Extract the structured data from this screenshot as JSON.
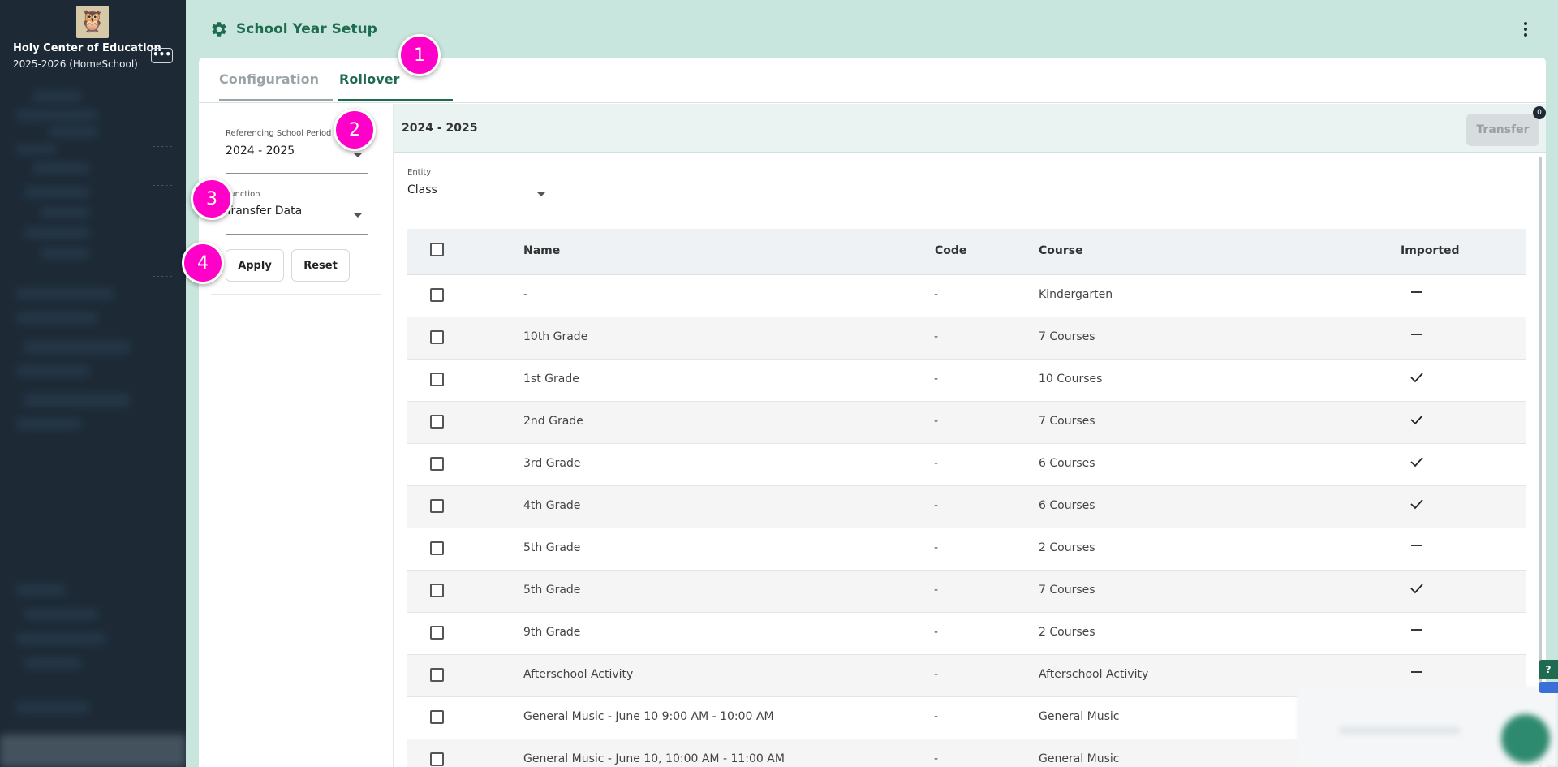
{
  "sidebar": {
    "school_name": "Holy Center of Education",
    "school_year": "2025-2026 (HomeSchool)",
    "more_label": "•••",
    "logo_icon": "owl-logo"
  },
  "header": {
    "title": "School Year Setup",
    "icon": "gear-icon"
  },
  "tabs": [
    {
      "label": "Configuration",
      "active": false
    },
    {
      "label": "Rollover",
      "active": true
    }
  ],
  "filters": {
    "referencing_period_label": "Referencing School Period",
    "referencing_period_value": "2024 - 2025",
    "function_label": "Function",
    "function_value": "Transfer Data",
    "apply_label": "Apply",
    "reset_label": "Reset"
  },
  "content": {
    "period_title": "2024 - 2025",
    "transfer_label": "Transfer",
    "transfer_count": "0",
    "entity_label": "Entity",
    "entity_value": "Class"
  },
  "table": {
    "columns": [
      "Name",
      "Code",
      "Course",
      "Imported"
    ],
    "rows": [
      {
        "name": "-",
        "code": "-",
        "course": "Kindergarten",
        "imported": false
      },
      {
        "name": "10th Grade",
        "code": "-",
        "course": "7 Courses",
        "imported": false
      },
      {
        "name": "1st Grade",
        "code": "-",
        "course": "10 Courses",
        "imported": true
      },
      {
        "name": "2nd Grade",
        "code": "-",
        "course": "7 Courses",
        "imported": true
      },
      {
        "name": "3rd Grade",
        "code": "-",
        "course": "6 Courses",
        "imported": true
      },
      {
        "name": "4th Grade",
        "code": "-",
        "course": "6 Courses",
        "imported": true
      },
      {
        "name": "5th Grade",
        "code": "-",
        "course": "2 Courses",
        "imported": false
      },
      {
        "name": "5th Grade",
        "code": "-",
        "course": "7 Courses",
        "imported": true
      },
      {
        "name": "9th Grade",
        "code": "-",
        "course": "2 Courses",
        "imported": false
      },
      {
        "name": "Afterschool Activity",
        "code": "-",
        "course": "Afterschool Activity",
        "imported": false
      },
      {
        "name": "General Music - June 10 9:00 AM - 10:00 AM",
        "code": "-",
        "course": "General Music",
        "imported": false
      },
      {
        "name": "General Music - June 10, 10:00 AM - 11:00 AM",
        "code": "-",
        "course": "General Music",
        "imported": false
      }
    ]
  },
  "annotations": [
    "1",
    "2",
    "3",
    "4"
  ],
  "help_label": "?",
  "colors": {
    "accent": "#1f6b4f",
    "sidebar_bg": "#1d2a36",
    "page_bg": "#c8e6dd",
    "annotation": "#ff00c8"
  }
}
